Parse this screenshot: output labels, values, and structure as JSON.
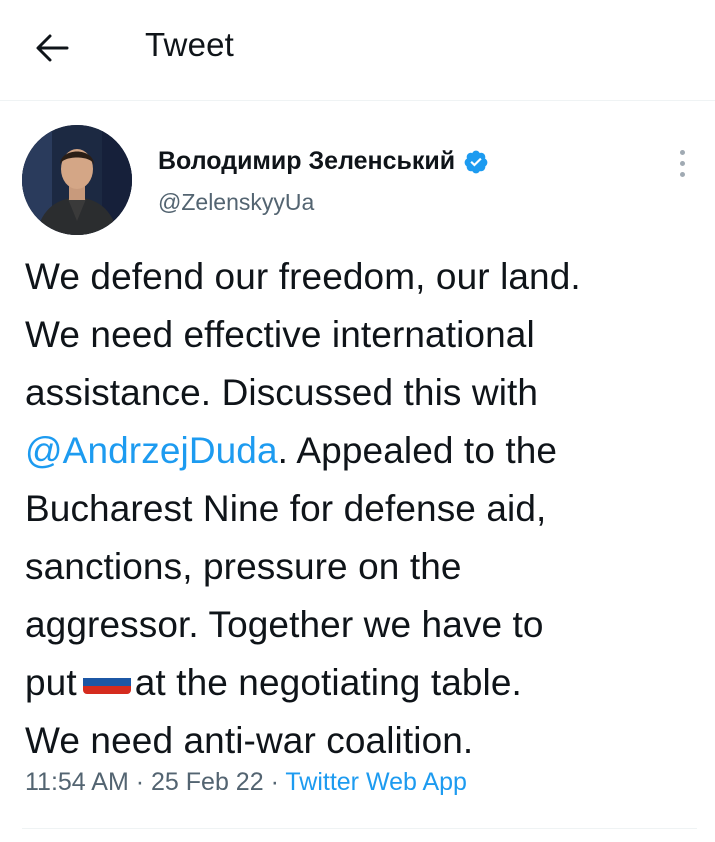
{
  "header": {
    "title": "Tweet"
  },
  "author": {
    "name": "Володимир Зеленський",
    "handle": "@ZelenskyyUa"
  },
  "tweet": {
    "lines": [
      {
        "before": "We defend our freedom, our land.",
        "mention": "",
        "after": ""
      },
      {
        "before": "We need effective international",
        "mention": "",
        "after": ""
      },
      {
        "before": "assistance. Discussed this with",
        "mention": "",
        "after": ""
      },
      {
        "before": "",
        "mention": "@AndrzejDuda",
        "after": ". Appealed to the"
      },
      {
        "before": "Bucharest Nine for defense aid,",
        "mention": "",
        "after": ""
      },
      {
        "before": "sanctions, pressure on the",
        "mention": "",
        "after": ""
      },
      {
        "before": "aggressor. Together we have to",
        "mention": "",
        "after": ""
      },
      {
        "before": "put",
        "flag": "russia-flag",
        "after": "at the negotiating table."
      },
      {
        "before": "We need anti-war coalition.",
        "mention": "",
        "after": ""
      }
    ]
  },
  "meta": {
    "time": "11:54 AM",
    "separator": "·",
    "date": "25 Feb 22",
    "source": "Twitter Web App"
  },
  "colors": {
    "link": "#1d9bf0",
    "secondary_text": "#536471",
    "verified": "#1d9bf0",
    "flag_white": "#ffffff",
    "flag_blue": "#1c57a5",
    "flag_red": "#d52b1e"
  }
}
